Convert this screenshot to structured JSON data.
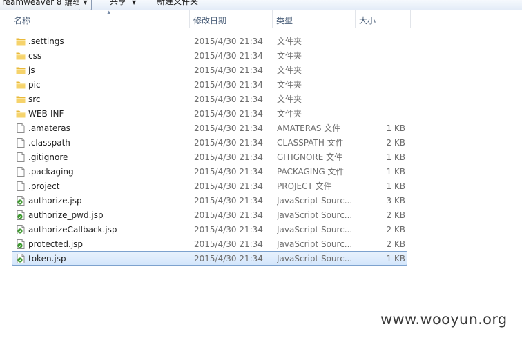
{
  "toolbar": {
    "open_with_label": "reamweaver 8 编辑",
    "share_label": "共享",
    "new_folder_label": "新建文件夹"
  },
  "columns": {
    "name": "名称",
    "date": "修改日期",
    "type": "类型",
    "size": "大小"
  },
  "files": [
    {
      "name": ".settings",
      "date": "2015/4/30 21:34",
      "type": "文件夹",
      "size": "",
      "kind": "folder-icon"
    },
    {
      "name": "css",
      "date": "2015/4/30 21:34",
      "type": "文件夹",
      "size": "",
      "kind": "folder-icon"
    },
    {
      "name": "js",
      "date": "2015/4/30 21:34",
      "type": "文件夹",
      "size": "",
      "kind": "folder-icon"
    },
    {
      "name": "pic",
      "date": "2015/4/30 21:34",
      "type": "文件夹",
      "size": "",
      "kind": "folder-icon"
    },
    {
      "name": "src",
      "date": "2015/4/30 21:34",
      "type": "文件夹",
      "size": "",
      "kind": "folder-icon"
    },
    {
      "name": "WEB-INF",
      "date": "2015/4/30 21:34",
      "type": "文件夹",
      "size": "",
      "kind": "folder-icon"
    },
    {
      "name": ".amateras",
      "date": "2015/4/30 21:34",
      "type": "AMATERAS 文件",
      "size": "1 KB",
      "kind": "file-icon"
    },
    {
      "name": ".classpath",
      "date": "2015/4/30 21:34",
      "type": "CLASSPATH 文件",
      "size": "2 KB",
      "kind": "file-icon"
    },
    {
      "name": ".gitignore",
      "date": "2015/4/30 21:34",
      "type": "GITIGNORE 文件",
      "size": "1 KB",
      "kind": "file-icon"
    },
    {
      "name": ".packaging",
      "date": "2015/4/30 21:34",
      "type": "PACKAGING 文件",
      "size": "1 KB",
      "kind": "file-icon"
    },
    {
      "name": ".project",
      "date": "2015/4/30 21:34",
      "type": "PROJECT 文件",
      "size": "1 KB",
      "kind": "file-icon"
    },
    {
      "name": "authorize.jsp",
      "date": "2015/4/30 21:34",
      "type": "JavaScript Sourc...",
      "size": "3 KB",
      "kind": "jsp-file-icon"
    },
    {
      "name": "authorize_pwd.jsp",
      "date": "2015/4/30 21:34",
      "type": "JavaScript Sourc...",
      "size": "2 KB",
      "kind": "jsp-file-icon"
    },
    {
      "name": "authorizeCallback.jsp",
      "date": "2015/4/30 21:34",
      "type": "JavaScript Sourc...",
      "size": "2 KB",
      "kind": "jsp-file-icon"
    },
    {
      "name": "protected.jsp",
      "date": "2015/4/30 21:34",
      "type": "JavaScript Sourc...",
      "size": "2 KB",
      "kind": "jsp-file-icon"
    },
    {
      "name": "token.jsp",
      "date": "2015/4/30 21:34",
      "type": "JavaScript Sourc...",
      "size": "1 KB",
      "kind": "jsp-file-icon",
      "selected": true
    }
  ],
  "watermark": "www.wooyun.org",
  "colors": {
    "selection_bg": "#d4e6fb",
    "selection_border": "#7da2ce",
    "folder": "#f1c650",
    "jsp_accent": "#3e9a2f"
  }
}
